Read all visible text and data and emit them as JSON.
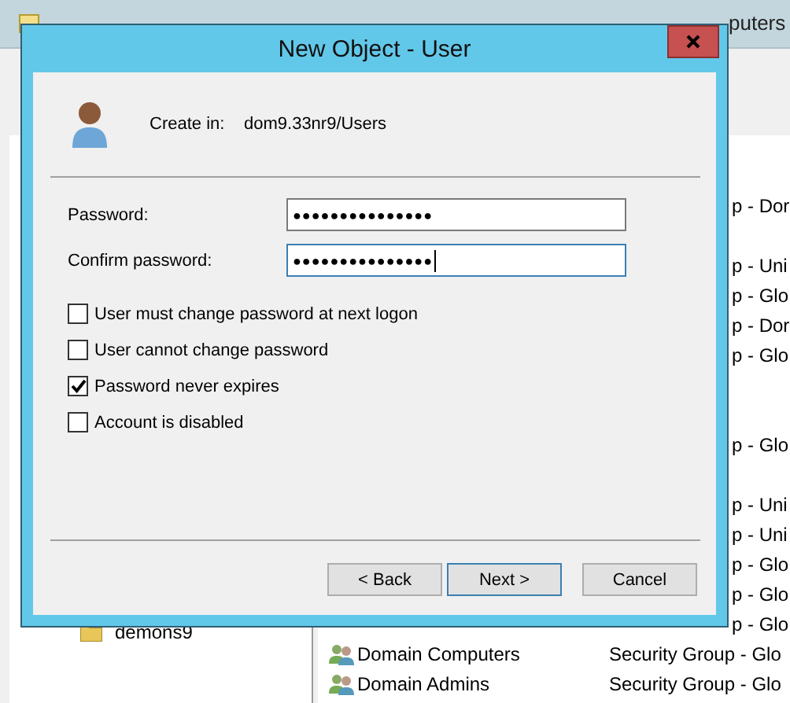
{
  "background_window": {
    "title": "puters",
    "tree_items": [
      {
        "label": "demons9"
      }
    ],
    "rows": [
      {
        "kind": "covered",
        "type": "p - Dor"
      },
      {
        "kind": "covered"
      },
      {
        "kind": "covered",
        "type": "p - Uni"
      },
      {
        "kind": "covered",
        "type": "p - Glo"
      },
      {
        "kind": "covered",
        "type": "p - Dor"
      },
      {
        "kind": "covered",
        "type": "p - Glo"
      },
      {
        "kind": "covered"
      },
      {
        "kind": "covered"
      },
      {
        "kind": "covered",
        "type": "p - Glo"
      },
      {
        "kind": "covered"
      },
      {
        "kind": "covered",
        "type": "p - Uni"
      },
      {
        "kind": "covered",
        "type": "p - Uni"
      },
      {
        "kind": "covered",
        "type": "p - Glo"
      },
      {
        "kind": "covered",
        "type": "p - Glo"
      },
      {
        "kind": "covered",
        "type": "p - Glo"
      },
      {
        "kind": "full",
        "name": "Domain Computers",
        "type": "Security Group - Glo"
      },
      {
        "kind": "full",
        "name": "Domain Admins",
        "type": "Security Group - Glo"
      }
    ]
  },
  "dialog": {
    "title": "New Object - User",
    "create_in_label": "Create in:",
    "create_in_value": "dom9.33nr9/Users",
    "fields": [
      {
        "label": "Password:",
        "value": "●●●●●●●●●●●●●●●",
        "focused": false
      },
      {
        "label": "Confirm password:",
        "value": "●●●●●●●●●●●●●●●",
        "focused": true
      }
    ],
    "options": [
      {
        "label": "User must change password at next logon",
        "checked": false
      },
      {
        "label": "User cannot change password",
        "checked": false
      },
      {
        "label": "Password never expires",
        "checked": true
      },
      {
        "label": "Account is disabled",
        "checked": false
      }
    ],
    "buttons": [
      {
        "label": "< Back",
        "default": false
      },
      {
        "label": "Next >",
        "default": true
      },
      {
        "label": "Cancel",
        "default": false
      }
    ]
  }
}
